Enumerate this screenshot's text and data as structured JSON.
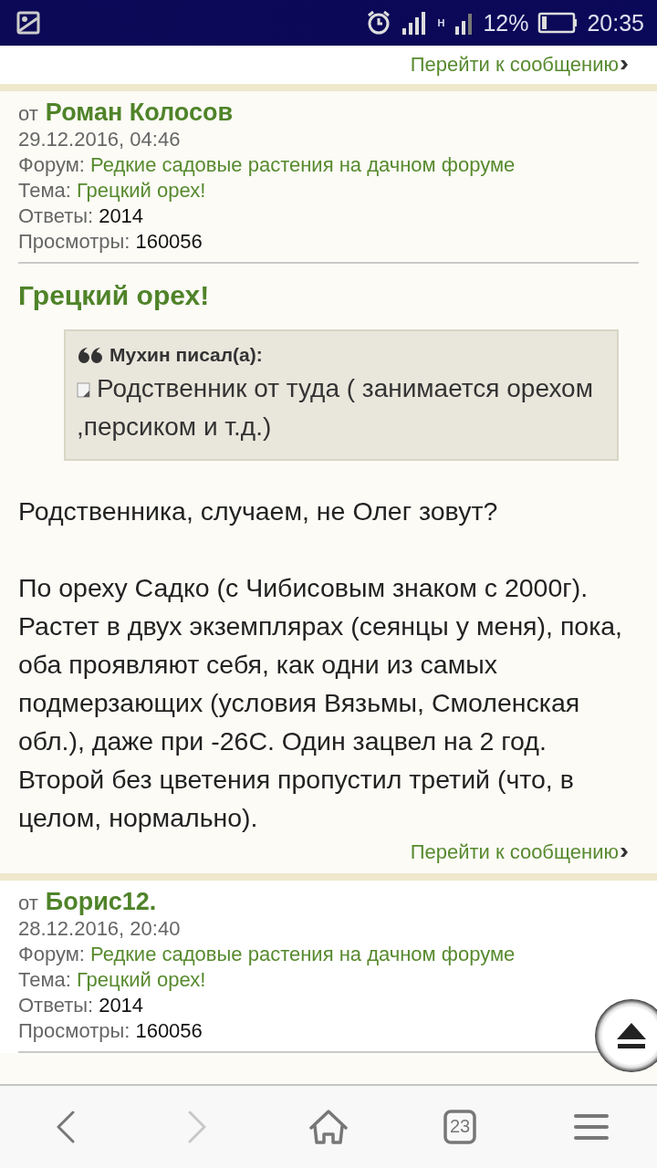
{
  "status_bar": {
    "battery": "12%",
    "time": "20:35",
    "network": "H"
  },
  "top_link": "Перейти к сообщению",
  "posts": [
    {
      "from_label": "от",
      "author": "Роман Колосов",
      "date": "29.12.2016, 04:46",
      "meta": [
        {
          "label": "Форум:",
          "value": "Редкие садовые растения на дачном форуме",
          "link": true
        },
        {
          "label": "Тема:",
          "value": "Грецкий орех!",
          "link": true
        },
        {
          "label": "Ответы:",
          "value": "2014",
          "link": false
        },
        {
          "label": "Просмотры:",
          "value": "160056",
          "link": false
        }
      ],
      "title": "Грецкий орех!",
      "quote": {
        "author": "Мухин писал(а):",
        "text": "Родственник от туда ( занимается орехом ,персиком и т.д.)"
      },
      "paragraphs": [
        "Родственника, случаем, не Олег зовут?",
        "По ореху Садко (с Чибисовым знаком с 2000г). Растет в двух экземплярах (сеянцы у меня), пока, оба проявляют себя, как одни из самых подмерзающих (условия Вязьмы, Смоленская обл.), даже при -26С. Один зацвел на 2 год. Второй без цветения пропустил третий (что, в целом, нормально)."
      ],
      "goto_link": "Перейти к сообщению"
    },
    {
      "from_label": "от",
      "author": "Борис12.",
      "date": "28.12.2016, 20:40",
      "meta": [
        {
          "label": "Форум:",
          "value": "Редкие садовые растения на дачном форуме",
          "link": true
        },
        {
          "label": "Тема:",
          "value": "Грецкий орех!",
          "link": true
        },
        {
          "label": "Ответы:",
          "value": "2014",
          "link": false
        },
        {
          "label": "Просмотры:",
          "value": "160056",
          "link": false
        }
      ]
    }
  ],
  "nav_buttons": [
    {
      "kind": "back",
      "disabled": false
    },
    {
      "kind": "forward",
      "disabled": true
    },
    {
      "kind": "home",
      "disabled": false
    },
    {
      "kind": "tabs",
      "label": "23",
      "disabled": false
    },
    {
      "kind": "menu",
      "disabled": false
    }
  ]
}
